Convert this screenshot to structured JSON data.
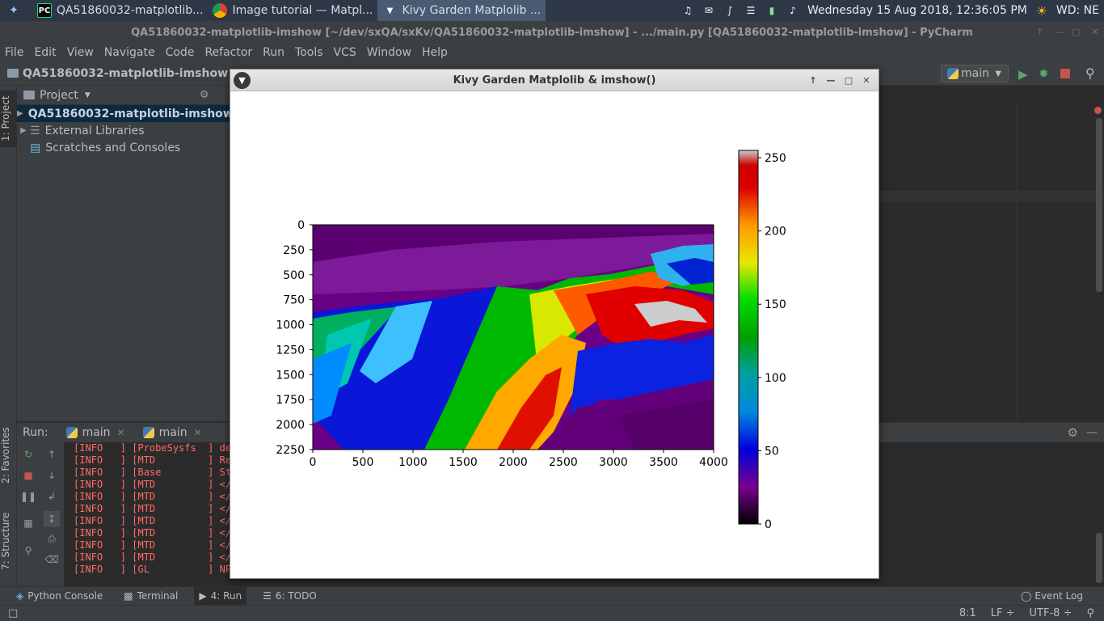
{
  "taskbar": {
    "apps": [
      {
        "label": "QA51860032-matplotlib...",
        "icon": "pycharm-icon"
      },
      {
        "label": "Image tutorial — Matpl...",
        "icon": "chrome-icon"
      },
      {
        "label": "Kivy Garden Matplolib ...",
        "icon": "kivy-icon"
      }
    ],
    "datetime": "Wednesday 15 Aug 2018, 12:36:05 PM",
    "workspace": "WD: NE"
  },
  "pycharm": {
    "title": "QA51860032-matplotlib-imshow [~/dev/sxQA/sxKv/QA51860032-matplotlib-imshow] - .../main.py [QA51860032-matplotlib-imshow] - PyCharm",
    "logo": "PC",
    "menu": [
      "File",
      "Edit",
      "View",
      "Navigate",
      "Code",
      "Refactor",
      "Run",
      "Tools",
      "VCS",
      "Window",
      "Help"
    ],
    "breadcrumb": "QA51860032-matplotlib-imshow",
    "run_config": "main",
    "project_header": "Project",
    "left_tabs": {
      "project": "1: Project",
      "favorites": "2: Favorites",
      "structure": "7: Structure"
    },
    "tree": [
      {
        "label": "QA51860032-matplotlib-imshow",
        "selected": true
      },
      {
        "label": "External Libraries",
        "selected": false
      },
      {
        "label": "Scratches and Consoles",
        "selected": false
      }
    ],
    "run_label": "Run:",
    "run_tabs": [
      "main",
      "main"
    ],
    "console": [
      "[INFO   ] [ProbeSysfs  ] dev",
      "[INFO   ] [MTD         ] Rea",
      "[INFO   ] [Base        ] Sta",
      "[INFO   ] [MTD         ] </c",
      "[INFO   ] [MTD         ] </c",
      "[INFO   ] [MTD         ] </c",
      "[INFO   ] [MTD         ] </c",
      "[INFO   ] [MTD         ] </c",
      "[INFO   ] [MTD         ] </c",
      "[INFO   ] [MTD         ] </c",
      "[INFO   ] [GL          ] NPO"
    ],
    "bottom_tabs": [
      "Python Console",
      "Terminal",
      "4: Run",
      "6: TODO"
    ],
    "event_log": "Event Log",
    "status": {
      "position": "8:1",
      "line_sep": "LF ÷",
      "encoding": "UTF-8 ÷"
    }
  },
  "kivy": {
    "title": "Kivy Garden Matplolib & imshow()"
  },
  "chart_data": {
    "type": "heatmap",
    "title": "",
    "colormap": "nipy_spectral",
    "x_ticks": [
      0,
      500,
      1000,
      1500,
      2000,
      2500,
      3000,
      3500,
      4000
    ],
    "y_ticks": [
      0,
      250,
      500,
      750,
      1000,
      1250,
      1500,
      1750,
      2000,
      2250
    ],
    "xlim": [
      0,
      4000
    ],
    "ylim": [
      2250,
      0
    ],
    "colorbar": {
      "ticks": [
        0,
        50,
        100,
        150,
        200,
        250
      ],
      "range": [
        0,
        255
      ]
    },
    "colors": {
      "low": "#000000",
      "purple": "#7a0090",
      "blue": "#0000dd",
      "cyan": "#00a0a0",
      "green": "#00cc00",
      "yellow": "#e8e800",
      "orange": "#ff9900",
      "red": "#dd0000",
      "high": "#cccccc"
    }
  }
}
